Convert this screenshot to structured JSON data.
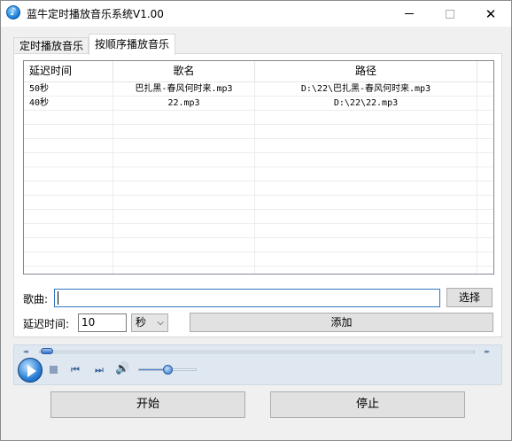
{
  "window": {
    "title": "蓝牛定时播放音乐系统V1.00",
    "icon": "music-note-icon",
    "controls": {
      "minimize_icon": "minimize-icon",
      "maximize_icon": "maximize-icon",
      "close_icon": "close-icon",
      "close_glyph": "✕"
    }
  },
  "tabs": [
    {
      "label": "定时播放音乐",
      "selected": false
    },
    {
      "label": "按顺序播放音乐",
      "selected": true
    }
  ],
  "playlist": {
    "columns": [
      "延迟时间",
      "歌名",
      "路径"
    ],
    "rows": [
      {
        "delay": "50秒",
        "song": "巴扎黑-春风何时来.mp3",
        "path": "D:\\22\\巴扎黑-春风何时来.mp3"
      },
      {
        "delay": "40秒",
        "song": "22.mp3",
        "path": "D:\\22\\22.mp3"
      }
    ]
  },
  "form": {
    "song_label": "歌曲:",
    "song_value": "",
    "browse_label": "选择",
    "delay_label": "延迟时间:",
    "delay_value": "10",
    "unit_value": "秒",
    "unit_chevron": "⌵",
    "add_label": "添加"
  },
  "player": {
    "seek_back_glyph": "◂◂",
    "seek_forward_glyph": "▸▸",
    "prev_glyph": "⏮",
    "next_glyph": "⏭",
    "volume_glyph": "🔊",
    "position_fraction": 0.0,
    "volume_fraction": 0.5,
    "accent": "#2a7fd4"
  },
  "actions": {
    "start_label": "开始",
    "stop_label": "停止"
  }
}
